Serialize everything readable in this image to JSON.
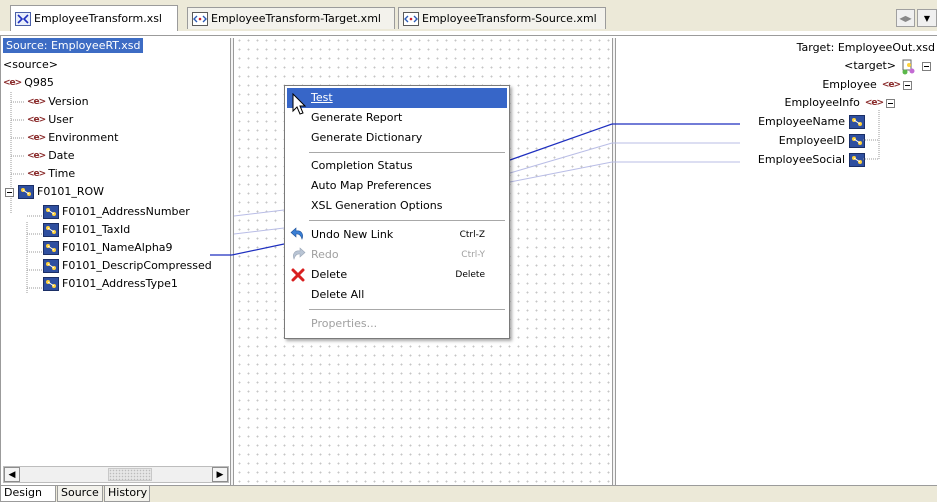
{
  "tabs": [
    {
      "label": "EmployeeTransform.xsl",
      "active": true
    },
    {
      "label": "EmployeeTransform-Target.xml",
      "active": false
    },
    {
      "label": "EmployeeTransform-Source.xml",
      "active": false
    }
  ],
  "source": {
    "title": "Source: EmployeeRT.xsd",
    "root": "<source>",
    "tags_glyph": "<e>",
    "group": "Q985",
    "elements": [
      "Version",
      "User",
      "Environment",
      "Date",
      "Time"
    ],
    "row": "F0101_ROW",
    "row_children": [
      "F0101_AddressNumber",
      "F0101_TaxId",
      "F0101_NameAlpha9",
      "F0101_DescripCompressed",
      "F0101_AddressType1"
    ]
  },
  "target": {
    "title": "Target: EmployeeOut.xsd",
    "root": "<target>",
    "employee": "Employee",
    "employee_info": "EmployeeInfo",
    "children": [
      "EmployeeName",
      "EmployeeID",
      "EmployeeSocial"
    ]
  },
  "context_menu": {
    "items": [
      {
        "label": "Test",
        "highlighted": true
      },
      {
        "label": "Generate Report"
      },
      {
        "label": "Generate Dictionary"
      },
      {
        "label": "Completion Status"
      },
      {
        "label": "Auto Map Preferences"
      },
      {
        "label": "XSL Generation Options"
      },
      {
        "label": "Undo New Link",
        "shortcut": "Ctrl-Z",
        "icon": "undo-icon"
      },
      {
        "label": "Redo",
        "shortcut": "Ctrl-Y",
        "icon": "redo-icon",
        "disabled": true
      },
      {
        "label": "Delete",
        "shortcut": "Delete",
        "icon": "delete-x-icon"
      },
      {
        "label": "Delete All"
      },
      {
        "label": "Properties...",
        "disabled": true
      }
    ]
  },
  "bottom_tabs": [
    "Design",
    "Source",
    "History"
  ],
  "colors": {
    "selection": "#3766c8",
    "link_line": "#1e2fbf",
    "link_faint": "#b9bde6"
  }
}
